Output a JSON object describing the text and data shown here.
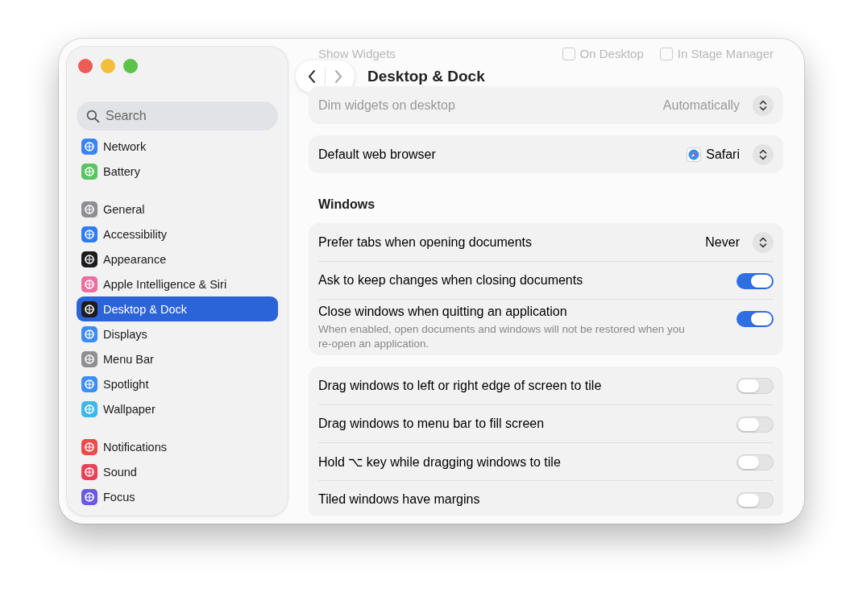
{
  "window": {
    "title": "Desktop & Dock"
  },
  "search": {
    "placeholder": "Search"
  },
  "sidebar": {
    "groups": [
      {
        "items": [
          {
            "label": "Network",
            "color": "#3b82f6",
            "selected": false
          },
          {
            "label": "Battery",
            "color": "#5ac463",
            "selected": false
          }
        ]
      },
      {
        "items": [
          {
            "label": "General",
            "color": "#8e8e93",
            "selected": false
          },
          {
            "label": "Accessibility",
            "color": "#2f7cf6",
            "selected": false
          },
          {
            "label": "Appearance",
            "color": "#1c1c1e",
            "selected": false
          },
          {
            "label": "Apple Intelligence & Siri",
            "color": "#e86fa0",
            "selected": false
          },
          {
            "label": "Desktop & Dock",
            "color": "#1c1c1e",
            "selected": true
          },
          {
            "label": "Displays",
            "color": "#3b8cf6",
            "selected": false
          },
          {
            "label": "Menu Bar",
            "color": "#8e8e93",
            "selected": false
          },
          {
            "label": "Spotlight",
            "color": "#3d8ef7",
            "selected": false
          },
          {
            "label": "Wallpaper",
            "color": "#3fb8e8",
            "selected": false
          }
        ]
      },
      {
        "items": [
          {
            "label": "Notifications",
            "color": "#eb4b4b",
            "selected": false
          },
          {
            "label": "Sound",
            "color": "#e8415a",
            "selected": false
          },
          {
            "label": "Focus",
            "color": "#6a5ae0",
            "selected": false
          }
        ]
      }
    ]
  },
  "faded_row": {
    "label": "Show Widgets",
    "options": [
      {
        "label": "On Desktop",
        "checked": false
      },
      {
        "label": "In Stage Manager",
        "checked": false
      }
    ]
  },
  "sections": [
    {
      "cards": [
        {
          "faded": true,
          "rows": [
            {
              "kind": "popup",
              "label": "Dim widgets on desktop",
              "value": "Automatically"
            }
          ]
        },
        {
          "faded": false,
          "rows": [
            {
              "kind": "popup",
              "label": "Default web browser",
              "value": "Safari",
              "app_icon": true
            }
          ]
        }
      ]
    },
    {
      "heading": "Windows",
      "cards": [
        {
          "faded": false,
          "rows": [
            {
              "kind": "popup",
              "label": "Prefer tabs when opening documents",
              "value": "Never"
            },
            {
              "kind": "toggle",
              "label": "Ask to keep changes when closing documents",
              "on": true
            },
            {
              "kind": "toggle",
              "label": "Close windows when quitting an application",
              "on": true,
              "description": "When enabled, open documents and windows will not be restored when you re-open an application."
            }
          ]
        },
        {
          "faded": false,
          "rows": [
            {
              "kind": "toggle",
              "label": "Drag windows to left or right edge of screen to tile",
              "on": false
            },
            {
              "kind": "toggle",
              "label": "Drag windows to menu bar to fill screen",
              "on": false
            },
            {
              "kind": "toggle",
              "label": "Hold ⌥ key while dragging windows to tile",
              "on": false
            },
            {
              "kind": "toggle",
              "label": "Tiled windows have margins",
              "on": false
            }
          ]
        }
      ]
    }
  ]
}
